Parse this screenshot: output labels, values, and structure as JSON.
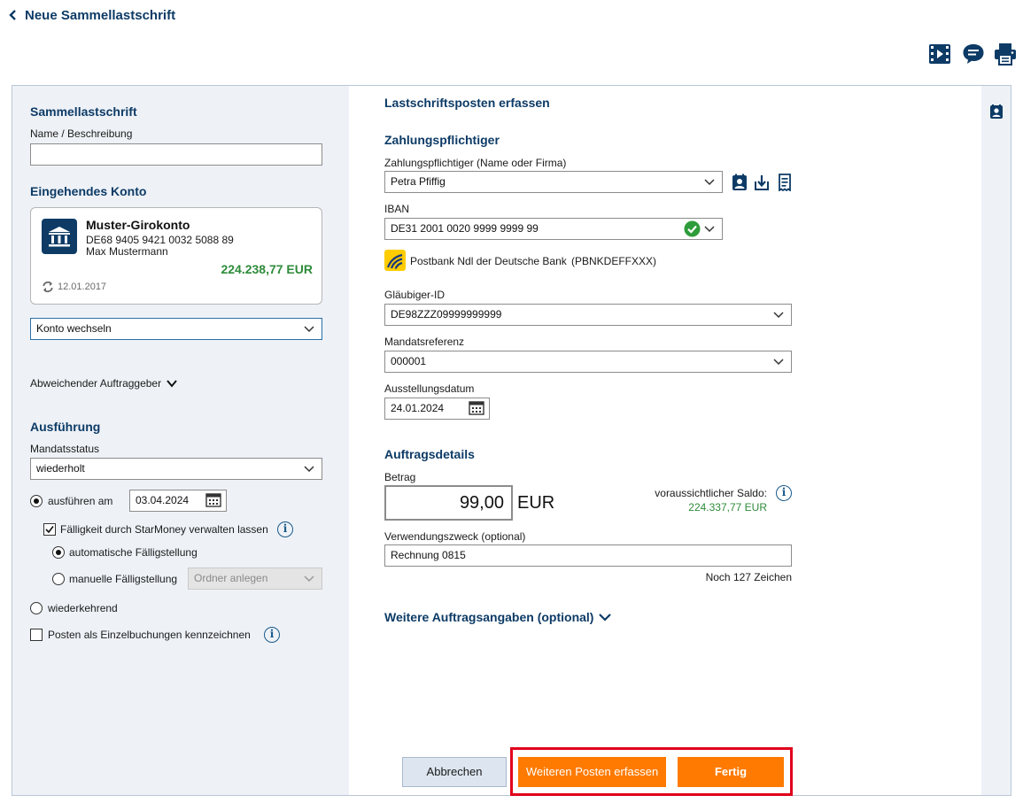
{
  "header": {
    "back_label": "Neue Sammellastschrift",
    "icons": [
      "video-icon",
      "chat-icon",
      "print-icon"
    ]
  },
  "left": {
    "section_title": "Sammellastschrift",
    "name_label": "Name / Beschreibung",
    "name_value": "",
    "konto_title": "Eingehendes Konto",
    "account": {
      "name": "Muster-Girokonto",
      "iban": "DE68 9405 9421 0032 5088 89",
      "owner": "Max Mustermann",
      "balance": "224.238,77 EUR",
      "sync_date": "12.01.2017"
    },
    "konto_select": "Konto wechseln",
    "abweichender": "Abweichender Auftraggeber",
    "ausfuehrung_title": "Ausführung",
    "mandatsstatus_label": "Mandatsstatus",
    "mandatsstatus_value": "wiederholt",
    "ausfuehren_label": "ausführen am",
    "ausfuehren_date": "03.04.2024",
    "faelligkeit_label": "Fälligkeit durch StarMoney verwalten lassen",
    "auto_label": "automatische Fälligstellung",
    "manuell_label": "manuelle Fälligstellung",
    "ordner_placeholder": "Ordner anlegen",
    "wiederkehrend_label": "wiederkehrend",
    "einzelbuchungen_label": "Posten als Einzelbuchungen kennzeichnen"
  },
  "main": {
    "title": "Lastschriftsposten erfassen",
    "payer_title": "Zahlungspflichtiger",
    "payer_label": "Zahlungspflichtiger (Name oder Firma)",
    "payer_value": "Petra Pfiffig",
    "iban_label": "IBAN",
    "iban_value": "DE31 2001 0020 9999 9999 99",
    "bank_name": "Postbank Ndl der Deutsche Bank",
    "bank_bic": "(PBNKDEFFXXX)",
    "glaeubiger_label": "Gläubiger-ID",
    "glaeubiger_value": "DE98ZZZ09999999999",
    "mandat_label": "Mandatsreferenz",
    "mandat_value": "000001",
    "ausstellung_label": "Ausstellungsdatum",
    "ausstellung_value": "24.01.2024",
    "details_title": "Auftragsdetails",
    "betrag_label": "Betrag",
    "betrag_value": "99,00",
    "currency": "EUR",
    "saldo_label": "voraussichtlicher Saldo:",
    "saldo_value": "224.337,77 EUR",
    "zweck_label": "Verwendungszweck (optional)",
    "zweck_value": "Rechnung 0815",
    "chars_left": "Noch 127 Zeichen",
    "weitere_label": "Weitere Auftragsangaben (optional)"
  },
  "buttons": {
    "cancel": "Abbrechen",
    "more": "Weiteren Posten erfassen",
    "done": "Fertig"
  },
  "colors": {
    "accent_orange": "#ff7a00",
    "navy": "#0d3b66",
    "green_amount": "#2e8b3a",
    "highlight_red": "#e0001b"
  }
}
